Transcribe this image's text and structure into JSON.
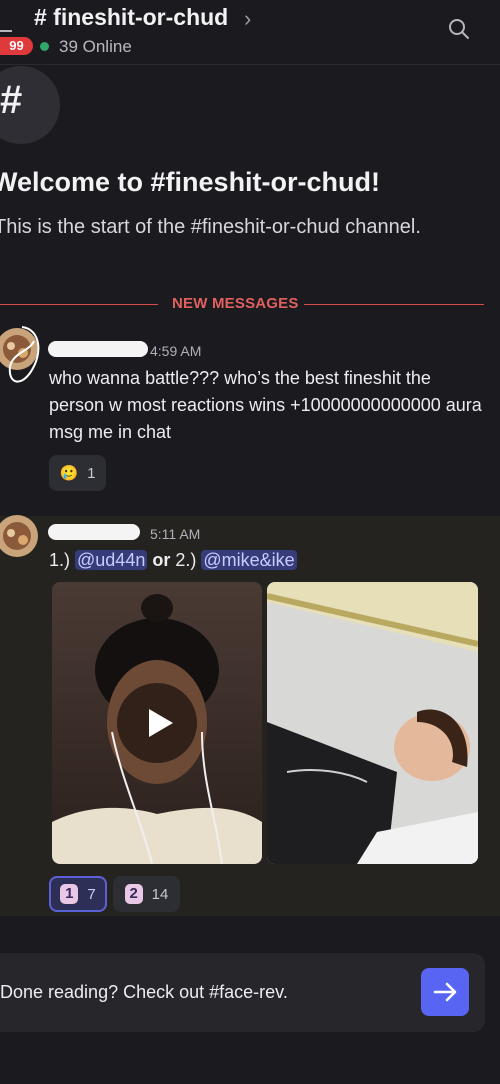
{
  "header": {
    "channel_title": "# fineshit-or-chud",
    "chevron": "›",
    "unread_badge": "99",
    "online_text": "39 Online"
  },
  "welcome": {
    "hash": "#",
    "title": "Welcome to #fineshit-or-chud!",
    "subtitle": "This is the start of the #fineshit-or-chud channel."
  },
  "divider": {
    "label": "NEW MESSAGES"
  },
  "messages": [
    {
      "timestamp": "4:59 AM",
      "text": "who wanna battle??? who’s the best fineshit the person w most reactions wins +10000000000000 aura msg me in chat",
      "reactions": [
        {
          "emoji": "🥲",
          "count": "1"
        }
      ]
    },
    {
      "timestamp": "5:11 AM",
      "parts": {
        "p1": "1.) ",
        "mention1": "@ud44n",
        "or": " or ",
        "p2": " 2.) ",
        "mention2": "@mike&ike"
      },
      "reactions": [
        {
          "emoji": "1",
          "count": "7",
          "selected": true
        },
        {
          "emoji": "2",
          "count": "14",
          "selected": false
        }
      ]
    }
  ],
  "footer": {
    "done_text": "Done reading? Check out #face-rev."
  },
  "colors": {
    "accent": "#5865f2",
    "danger": "#e0393c",
    "online": "#2fa86a",
    "mention_bg": "#363b7a"
  }
}
